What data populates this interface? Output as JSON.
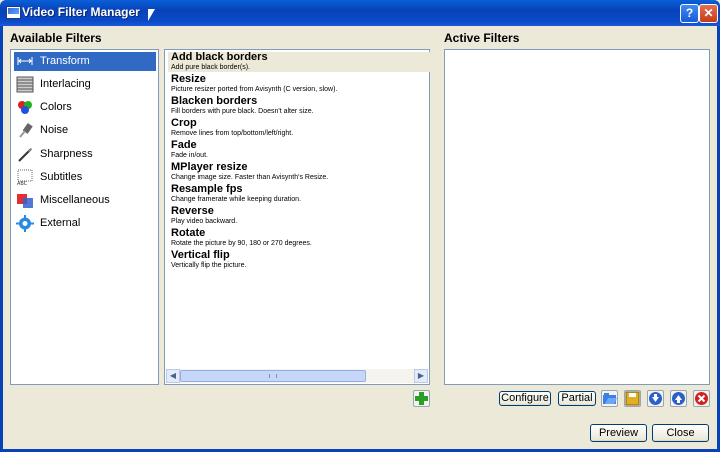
{
  "window": {
    "title": "Video Filter Manager",
    "help_label": "?",
    "close_label": "✕"
  },
  "available": {
    "label": "Available Filters",
    "categories": [
      {
        "label": "Transform",
        "icon": "transform-icon"
      },
      {
        "label": "Interlacing",
        "icon": "interlacing-icon"
      },
      {
        "label": "Colors",
        "icon": "colors-icon"
      },
      {
        "label": "Noise",
        "icon": "noise-icon"
      },
      {
        "label": "Sharpness",
        "icon": "sharpness-icon"
      },
      {
        "label": "Subtitles",
        "icon": "subtitles-icon"
      },
      {
        "label": "Miscellaneous",
        "icon": "miscellaneous-icon"
      },
      {
        "label": "External",
        "icon": "external-icon"
      }
    ],
    "selected_category": "Transform"
  },
  "filters": [
    {
      "name": "Add black borders",
      "desc": "Add pure black border(s)."
    },
    {
      "name": "Resize",
      "desc": "Picture resizer ported from Avisynth (C version, slow)."
    },
    {
      "name": "Blacken borders",
      "desc": "Fill borders with pure black. Doesn't alter size."
    },
    {
      "name": "Crop",
      "desc": "Remove lines from top/bottom/left/right."
    },
    {
      "name": "Fade",
      "desc": "Fade in/out."
    },
    {
      "name": "MPlayer resize",
      "desc": "Change image size. Faster than Avisynth's Resize."
    },
    {
      "name": "Resample fps",
      "desc": "Change framerate while keeping duration."
    },
    {
      "name": "Reverse",
      "desc": "Play video backward."
    },
    {
      "name": "Rotate",
      "desc": "Rotate the picture by 90, 180 or 270 degrees."
    },
    {
      "name": "Vertical flip",
      "desc": "Vertically flip the picture."
    }
  ],
  "active": {
    "label": "Active Filters"
  },
  "buttons": {
    "configure": "Configure",
    "partial": "Partial",
    "preview": "Preview",
    "close": "Close"
  },
  "colors": {
    "selection": "#316ac5",
    "title_bar": "#0842b8",
    "dialog": "#ece9d8"
  }
}
